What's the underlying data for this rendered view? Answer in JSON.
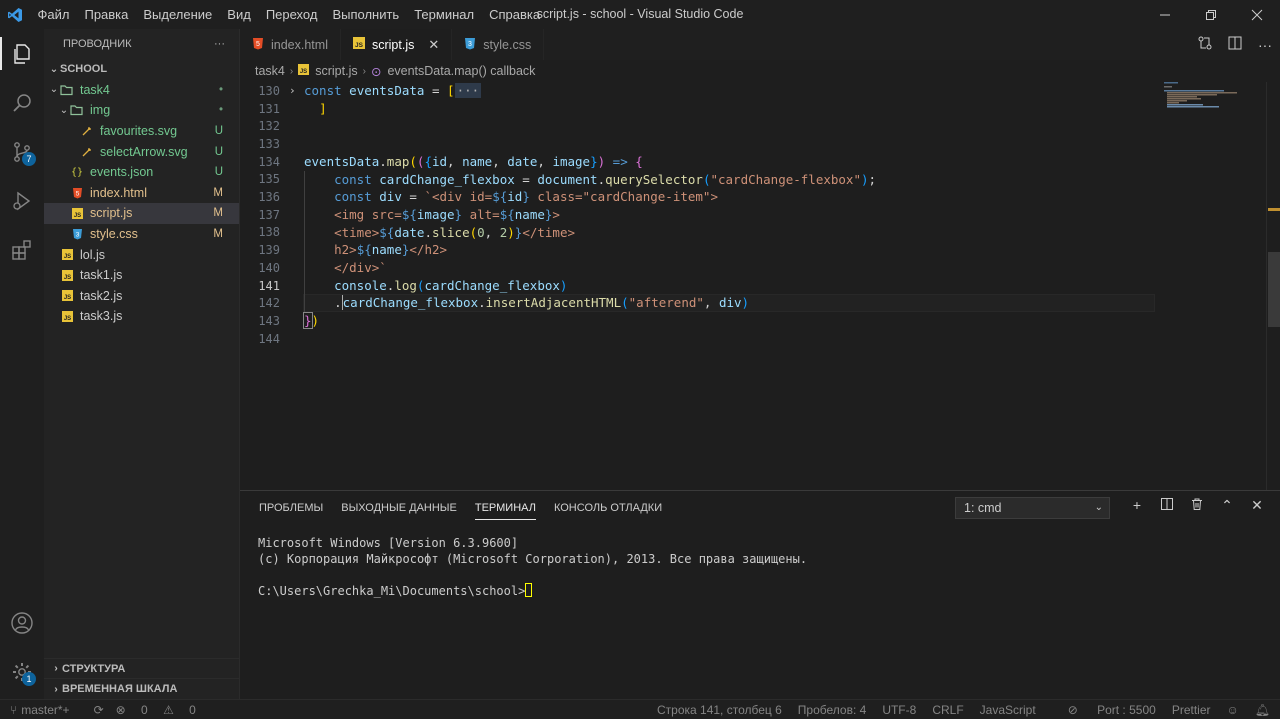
{
  "window": {
    "title": "script.js - school - Visual Studio Code",
    "menu": [
      "Файл",
      "Правка",
      "Выделение",
      "Вид",
      "Переход",
      "Выполнить",
      "Терминал",
      "Справка"
    ]
  },
  "sidebar": {
    "title": "ПРОВОДНИК",
    "more": "···",
    "root": "SCHOOL",
    "tree": [
      {
        "label": "task4",
        "status": "•",
        "kind": "folder-open",
        "depth": 0
      },
      {
        "label": "img",
        "status": "•",
        "kind": "folder-open",
        "depth": 1
      },
      {
        "label": "favourites.svg",
        "status": "U",
        "kind": "svg",
        "depth": 2
      },
      {
        "label": "selectArrow.svg",
        "status": "U",
        "kind": "svg",
        "depth": 2
      },
      {
        "label": "events.json",
        "status": "U",
        "kind": "json",
        "depth": 1
      },
      {
        "label": "index.html",
        "status": "M",
        "kind": "html",
        "depth": 1
      },
      {
        "label": "script.js",
        "status": "M",
        "kind": "js",
        "depth": 1
      },
      {
        "label": "style.css",
        "status": "M",
        "kind": "css",
        "depth": 1
      },
      {
        "label": "lol.js",
        "status": "",
        "kind": "js",
        "depth": 0
      },
      {
        "label": "task1.js",
        "status": "",
        "kind": "js",
        "depth": 0
      },
      {
        "label": "task2.js",
        "status": "",
        "kind": "js",
        "depth": 0
      },
      {
        "label": "task3.js",
        "status": "",
        "kind": "js",
        "depth": 0
      }
    ],
    "sections": [
      "СТРУКТУРА",
      "ВРЕМЕННАЯ ШКАЛА"
    ]
  },
  "tabs": [
    {
      "label": "index.html",
      "kind": "html"
    },
    {
      "label": "script.js",
      "kind": "js",
      "active": true,
      "close": "✕"
    },
    {
      "label": "style.css",
      "kind": "css"
    }
  ],
  "breadcrumb": {
    "folder": "task4",
    "file": "script.js",
    "symbol": "eventsData.map() callback"
  },
  "editor": {
    "line_numbers": [
      "130",
      "131",
      "132",
      "133",
      "134",
      "135",
      "136",
      "137",
      "138",
      "139",
      "140",
      "141",
      "142",
      "143",
      "144"
    ],
    "current_line": "141",
    "folded_text": "const eventsData = [",
    "folded_ellipsis": "···"
  },
  "panel": {
    "tabs": [
      "ПРОБЛЕМЫ",
      "ВЫХОДНЫЕ ДАННЫЕ",
      "ТЕРМИНАЛ",
      "КОНСОЛЬ ОТЛАДКИ"
    ],
    "active_tab": "ТЕРМИНАЛ",
    "terminal_select": "1: cmd",
    "terminal_lines": [
      "Microsoft Windows [Version 6.3.9600]",
      "(c) Корпорация Майкрософт (Microsoft Corporation), 2013. Все права защищены.",
      "",
      "C:\\Users\\Grechka_Mi\\Documents\\school>"
    ]
  },
  "statusbar": {
    "branch": "master*+",
    "errors": "0",
    "warnings": "0",
    "position": "Строка 141, столбец 6",
    "spaces": "Пробелов: 4",
    "encoding": "UTF-8",
    "eol": "CRLF",
    "language": "JavaScript",
    "port": "Port : 5500",
    "prettier": "Prettier"
  },
  "activity_badge": "7",
  "colors": {
    "modified": "#e2c08d",
    "untracked": "#73c991",
    "keyword": "#569cd6",
    "function": "#dcdcaa",
    "string": "#ce9178",
    "variable": "#9cdcfe"
  }
}
